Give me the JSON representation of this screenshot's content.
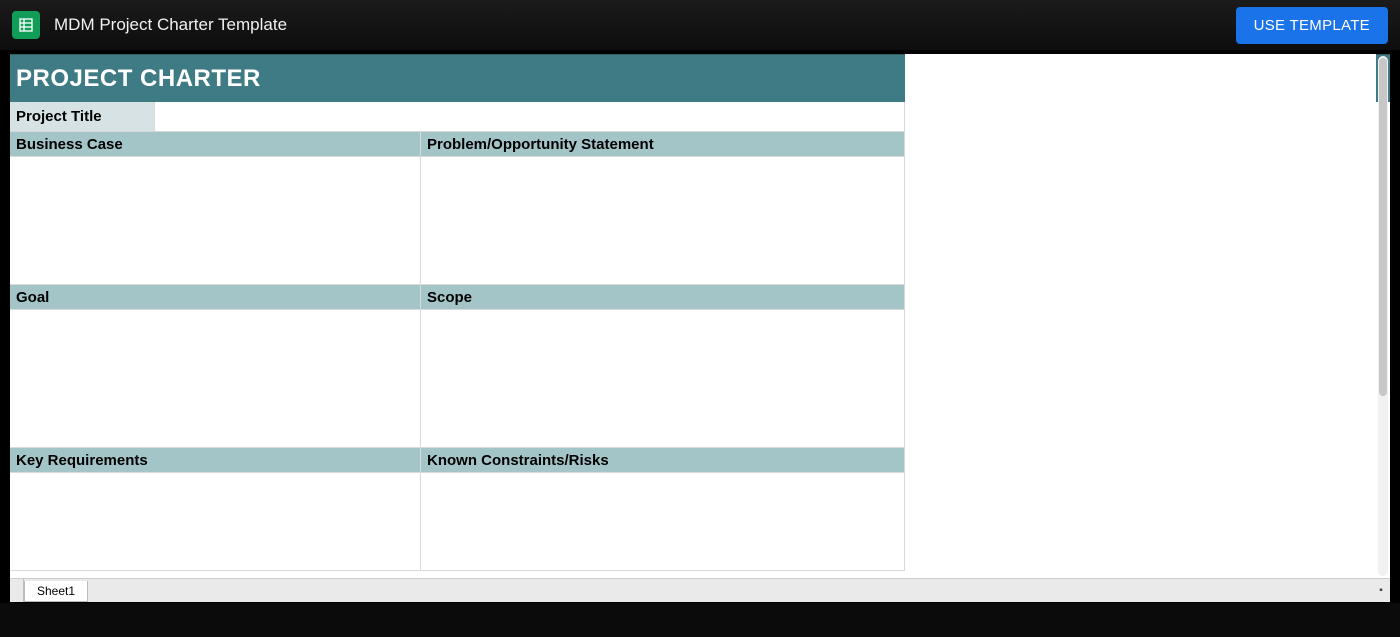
{
  "app": {
    "doc_title": "MDM Project Charter Template",
    "use_template_label": "USE TEMPLATE"
  },
  "charter": {
    "heading": "PROJECT CHARTER",
    "project_title_label": "Project Title",
    "project_title_value": "",
    "sections": {
      "business_case": "Business Case",
      "problem_statement": "Problem/Opportunity Statement",
      "goal": "Goal",
      "scope": "Scope",
      "key_requirements": "Key Requirements",
      "known_constraints": "Known Constraints/Risks"
    },
    "content": {
      "business_case": "",
      "problem_statement": "",
      "goal": "",
      "scope": "",
      "key_requirements": "",
      "known_constraints": ""
    }
  },
  "tabs": {
    "sheet1": "Sheet1",
    "collapse_glyph": "▪"
  }
}
